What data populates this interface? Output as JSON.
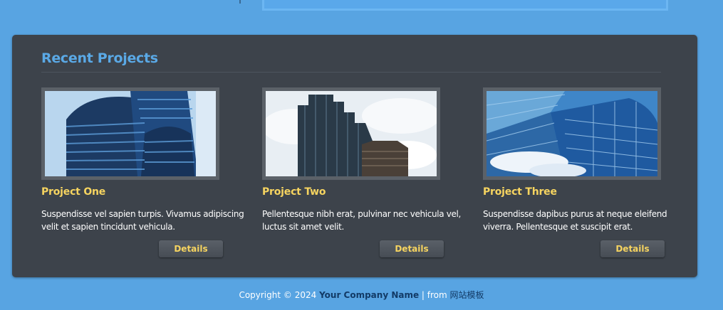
{
  "section": {
    "title": "Recent Projects"
  },
  "projects": [
    {
      "title": "Project One",
      "text": "Suspendisse vel sapien turpis. Vivamus adipiscing velit et sapien tincidunt vehicula.",
      "button_label": "Details",
      "image_icon": "office-building-photo"
    },
    {
      "title": "Project Two",
      "text": "Pellentesque nibh erat, pulvinar nec vehicula vel, luctus sit amet velit.",
      "button_label": "Details",
      "image_icon": "skyscrapers-photo"
    },
    {
      "title": "Project Three",
      "text": "Suspendisse dapibus purus at neque eleifend viverra. Pellentesque et suscipit erat.",
      "button_label": "Details",
      "image_icon": "glass-tower-photo"
    }
  ],
  "footer": {
    "prefix": "Copyright © 2024 ",
    "company": "Your Company Name",
    "separator": " | from ",
    "link": "网站模板"
  },
  "colors": {
    "background": "#58a4e2",
    "panel": "#3d434b",
    "title_blue": "#5aa9e6",
    "accent_yellow": "#f6d460"
  }
}
